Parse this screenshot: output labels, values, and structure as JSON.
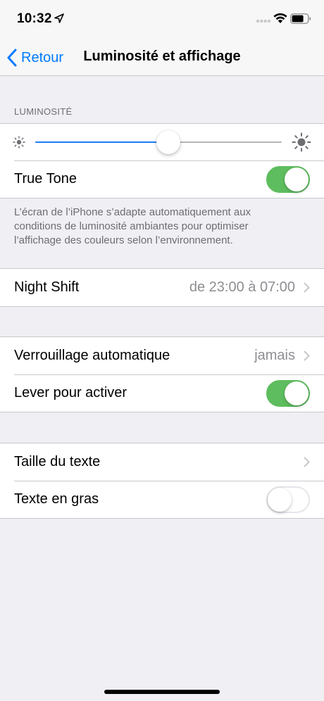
{
  "status": {
    "time": "10:32"
  },
  "nav": {
    "back_label": "Retour",
    "title": "Luminosité et affichage"
  },
  "brightness": {
    "section_header": "LUMINOSITÉ",
    "level": 0.54
  },
  "true_tone": {
    "label": "True Tone",
    "enabled": true,
    "footnote": "L’écran de l’iPhone s’adapte automatiquement aux conditions de luminosité ambiantes pour optimiser l’affichage des couleurs selon l’environnement."
  },
  "night_shift": {
    "label": "Night Shift",
    "value": "de 23:00 à 07:00"
  },
  "auto_lock": {
    "label": "Verrouillage automatique",
    "value": "jamais"
  },
  "raise_to_wake": {
    "label": "Lever pour activer",
    "enabled": true
  },
  "text_size": {
    "label": "Taille du texte"
  },
  "bold_text": {
    "label": "Texte en gras",
    "enabled": false
  },
  "colors": {
    "accent": "#007aff",
    "toggle_on": "#5ebd5e",
    "slider_fill": "#1e7cf5"
  }
}
